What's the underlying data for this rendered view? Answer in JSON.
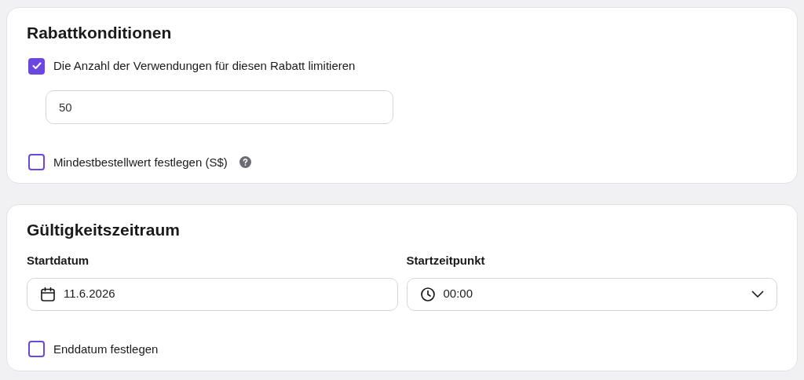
{
  "discount_conditions": {
    "title": "Rabattkonditionen",
    "limit_uses": {
      "label": "Die Anzahl der Verwendungen für diesen Rabatt limitieren",
      "checked": true,
      "value": "50"
    },
    "min_order": {
      "label": "Mindestbestellwert festlegen (S$)",
      "checked": false
    }
  },
  "validity": {
    "title": "Gültigkeitszeitraum",
    "start_date": {
      "label": "Startdatum",
      "value": "11.6.2026"
    },
    "start_time": {
      "label": "Startzeitpunkt",
      "value": "00:00"
    },
    "end_date": {
      "label": "Enddatum festlegen",
      "checked": false
    }
  }
}
